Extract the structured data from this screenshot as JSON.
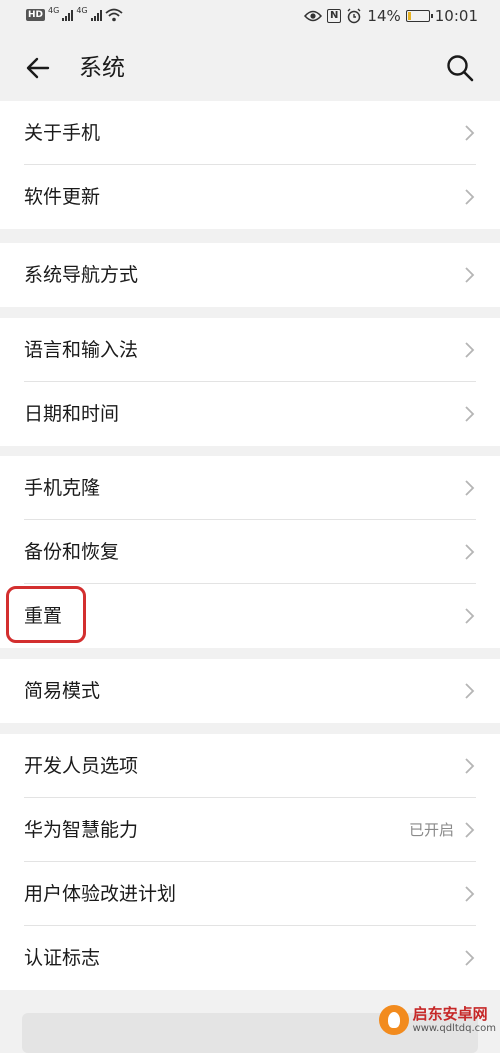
{
  "status_bar": {
    "hd": "HD",
    "net1": "4G",
    "net2": "4G",
    "nfc": "N",
    "battery_text": "14%",
    "battery_level": 0.14,
    "time": "10:01",
    "icons": [
      "wifi-icon",
      "eye-icon",
      "alarm-icon"
    ]
  },
  "header": {
    "title": "系统",
    "back_icon": "back-arrow-icon",
    "search_icon": "search-icon"
  },
  "groups": [
    {
      "items": [
        {
          "label": "关于手机"
        },
        {
          "label": "软件更新"
        }
      ]
    },
    {
      "items": [
        {
          "label": "系统导航方式"
        }
      ]
    },
    {
      "items": [
        {
          "label": "语言和输入法"
        },
        {
          "label": "日期和时间"
        }
      ]
    },
    {
      "items": [
        {
          "label": "手机克隆"
        },
        {
          "label": "备份和恢复"
        },
        {
          "label": "重置"
        }
      ]
    },
    {
      "items": [
        {
          "label": "简易模式"
        }
      ]
    },
    {
      "items": [
        {
          "label": "开发人员选项"
        },
        {
          "label": "华为智慧能力",
          "status": "已开启"
        },
        {
          "label": "用户体验改进计划"
        },
        {
          "label": "认证标志"
        }
      ]
    }
  ],
  "watermark": {
    "name": "启东安卓网",
    "url": "www.qdltdq.com"
  },
  "colors": {
    "highlight": "#d32f2f",
    "background": "#f1f1f1",
    "card": "#ffffff"
  }
}
